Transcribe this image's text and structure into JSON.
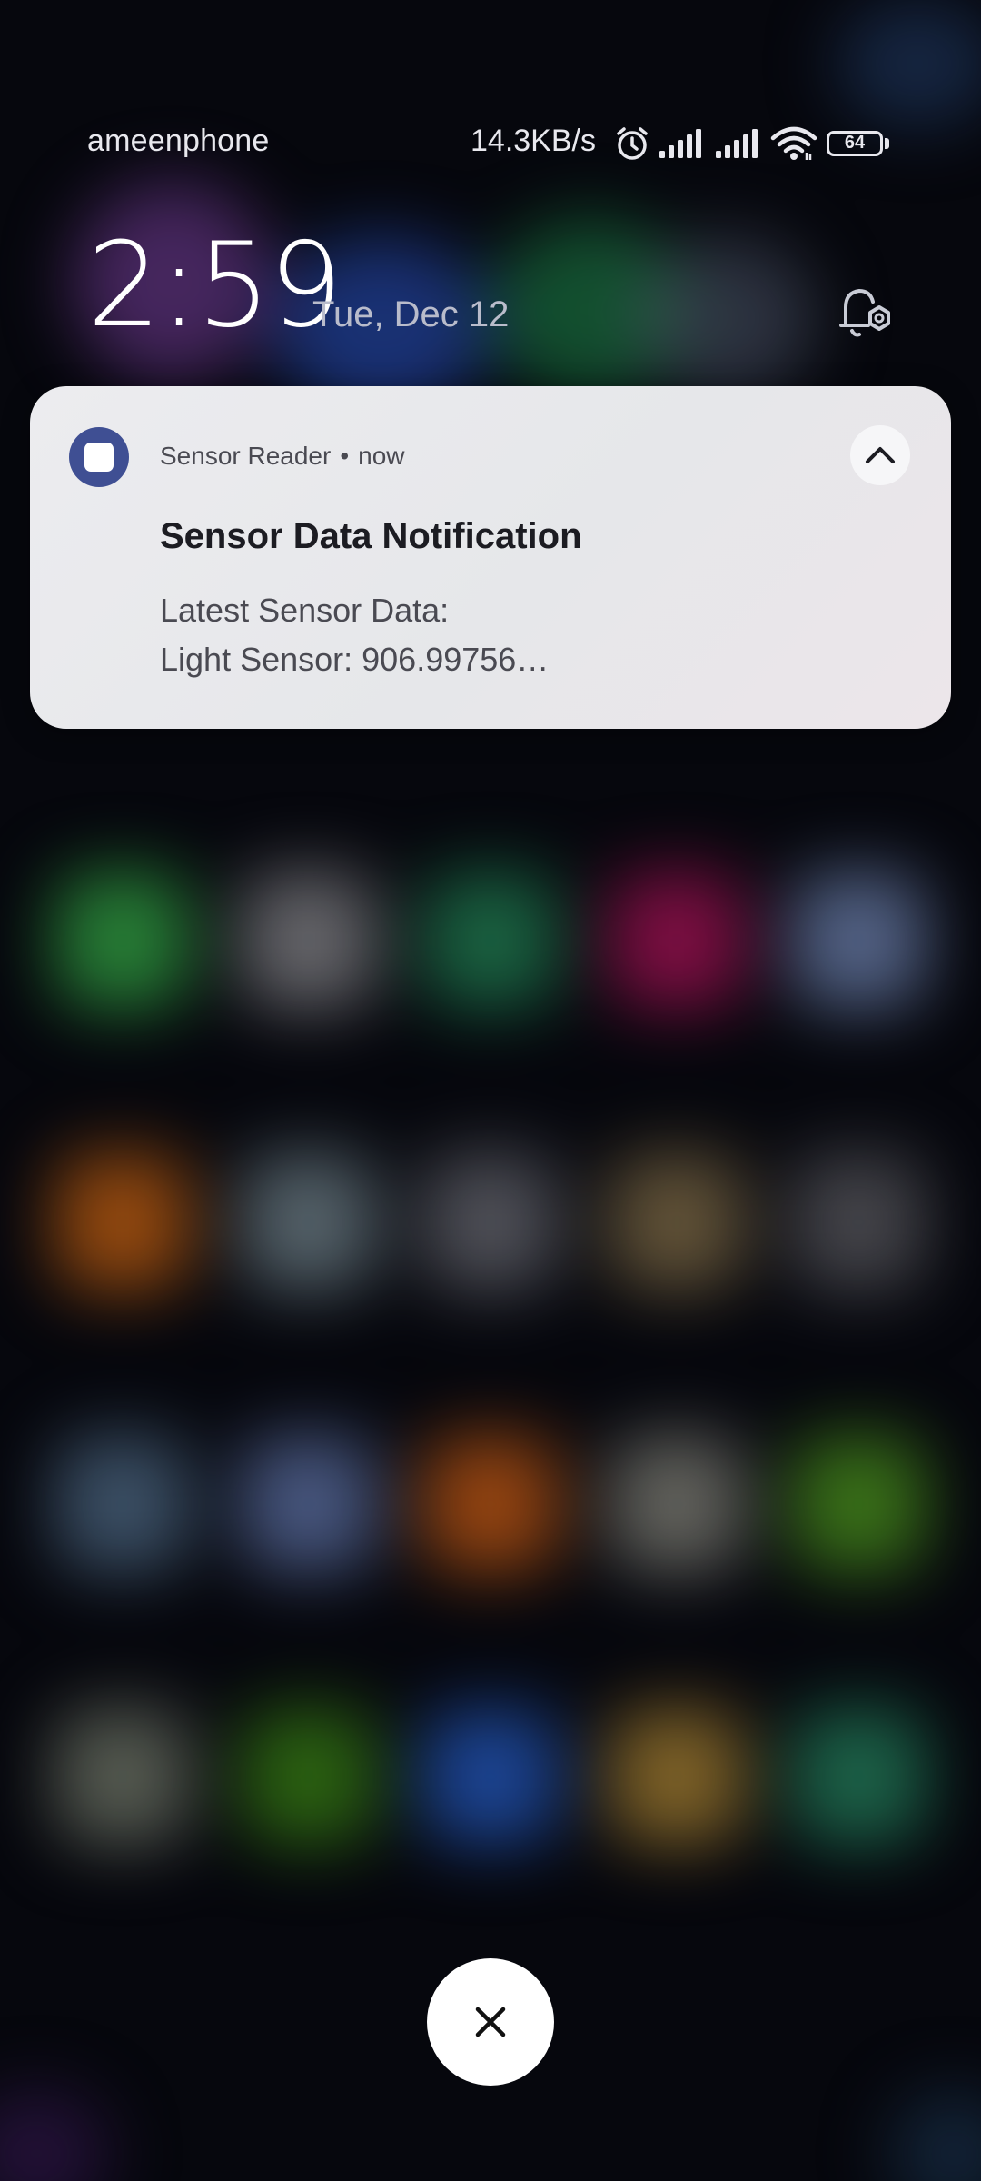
{
  "status_bar": {
    "carrier": "ameenphone",
    "net_speed": "14.3KB/s",
    "battery_level": "64",
    "icons": [
      "alarm-icon",
      "signal-sim1-icon",
      "signal-sim2-icon",
      "wifi-icon",
      "battery-icon"
    ]
  },
  "lockscreen": {
    "time": "2:59",
    "date": "Tue, Dec 12"
  },
  "notification": {
    "app_name": "Sensor Reader",
    "separator": "•",
    "time": "now",
    "title": "Sensor Data Notification",
    "body_line1": "Latest Sensor Data:",
    "body_line2": "Light Sensor: 906.99756…",
    "icon_color": "#3f4f93"
  },
  "actions": {
    "close_icon": "close-icon"
  }
}
